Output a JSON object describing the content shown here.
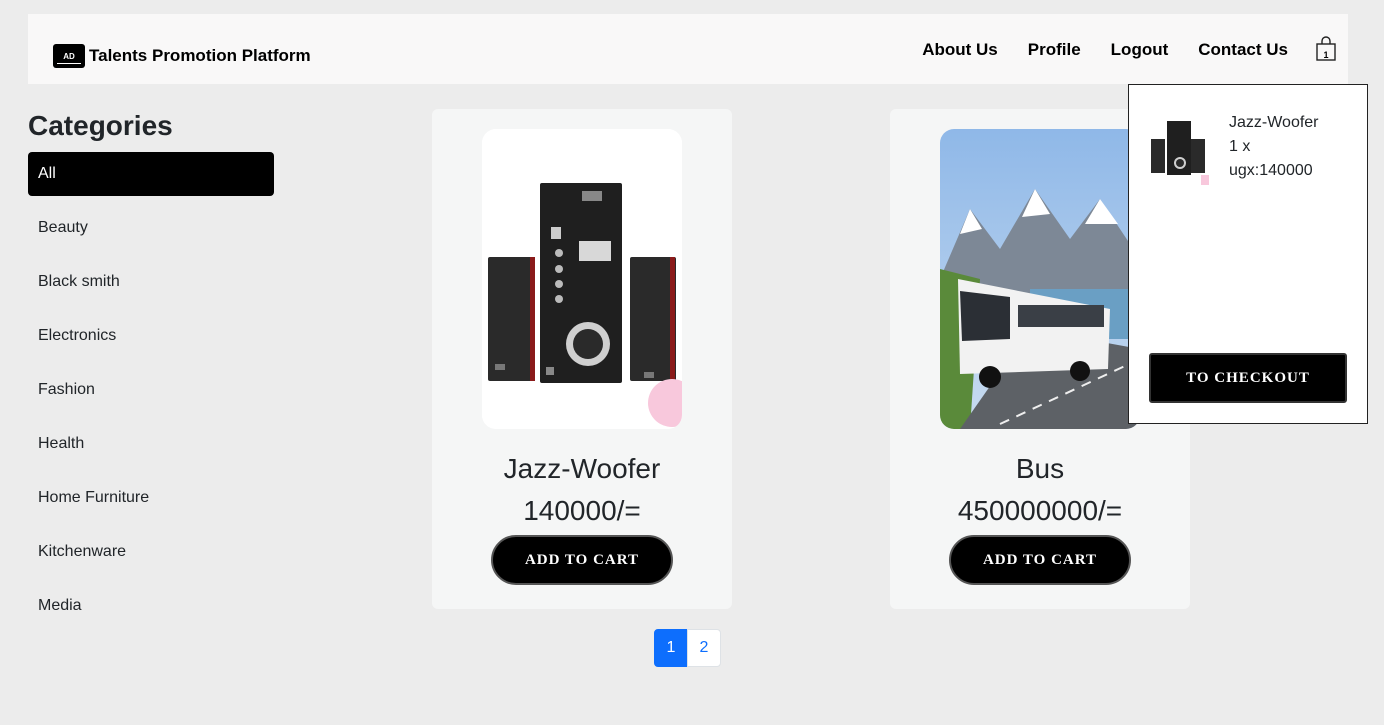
{
  "navbar": {
    "logo_text": "AD",
    "brand": "Talents Promotion Platform",
    "links": [
      "About Us",
      "Profile",
      "Logout",
      "Contact Us"
    ],
    "cart_icon": "shopping-bag-icon",
    "cart_count": "1"
  },
  "sidebar": {
    "title": "Categories",
    "items": [
      "All",
      "Beauty",
      "Black smith",
      "Electronics",
      "Fashion",
      "Health",
      "Home Furniture",
      "Kitchenware",
      "Media"
    ],
    "active": "All"
  },
  "products": [
    {
      "name": "Jazz-Woofer",
      "price": "140000/=",
      "button": "ADD TO CART"
    },
    {
      "name": "Bus",
      "price": "450000000/=",
      "button": "ADD TO CART"
    }
  ],
  "pagination": {
    "pages": [
      "1",
      "2"
    ],
    "current": "1"
  },
  "cart_dropdown": {
    "item_name": "Jazz-Woofer",
    "quantity": "1 x",
    "price": "ugx:140000",
    "checkout_label": "TO CHECKOUT"
  },
  "colors": {
    "accent": "#0d6efd",
    "button": "#000000",
    "page_bg": "#ececec"
  }
}
